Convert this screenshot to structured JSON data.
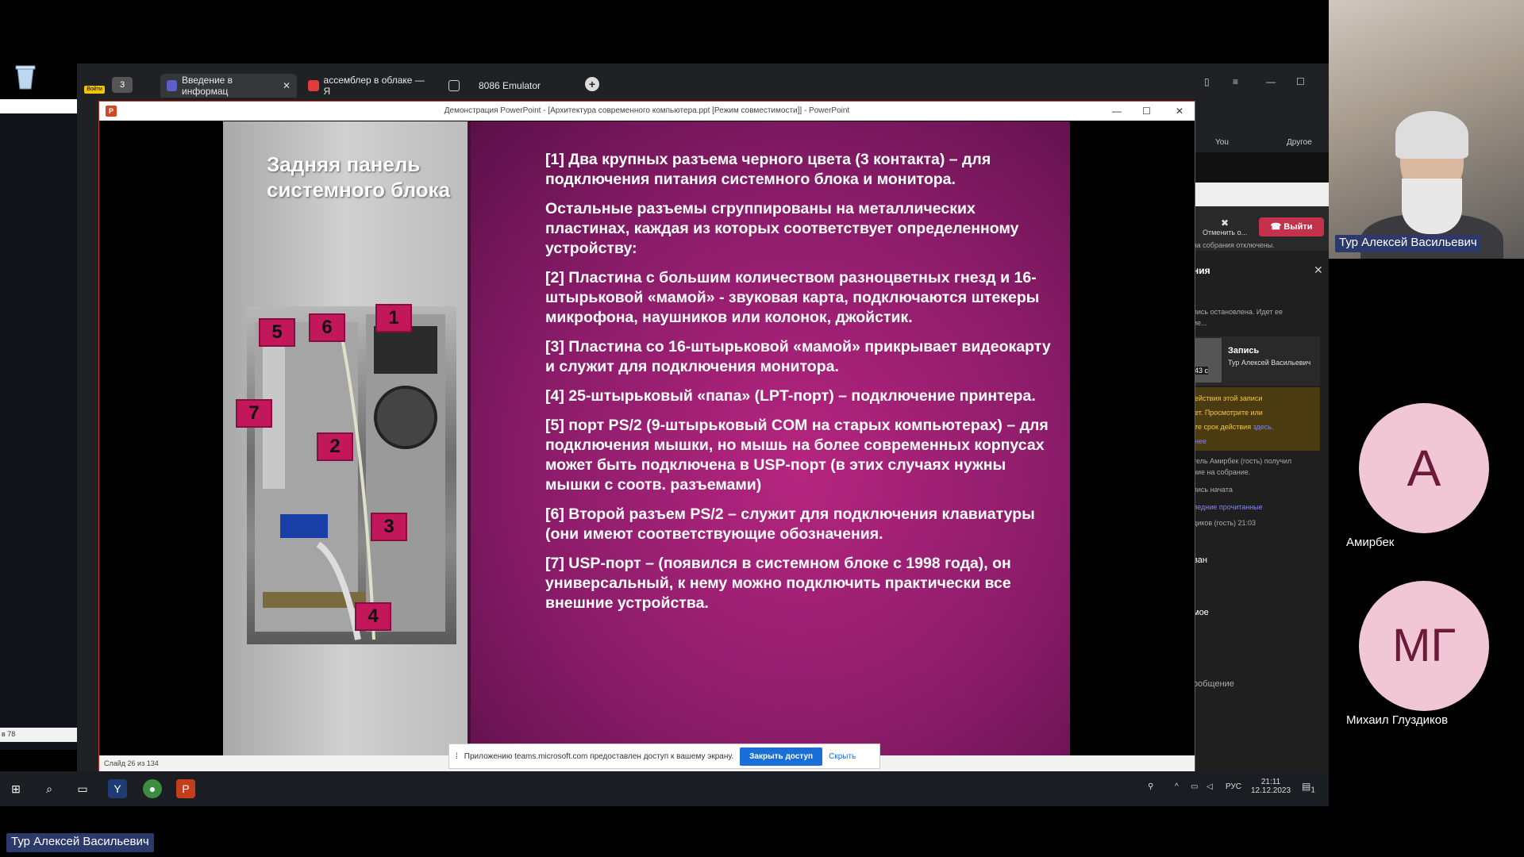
{
  "browser": {
    "tabs": [
      {
        "label": "Введение в информац"
      },
      {
        "label": "ассемблер в облаке — Я"
      },
      {
        "label": "8086 Emulator"
      }
    ],
    "tab_count": "3",
    "login_label": "Войти"
  },
  "ppt": {
    "window_title": "Демонстрация PowerPoint - [Архитектура современного компьютера.ppt [Режим совместимости]] - PowerPoint",
    "status": "Слайд 26 из 134"
  },
  "slide": {
    "heading": "Задняя панель системного блока",
    "callouts": [
      "1",
      "2",
      "3",
      "4",
      "5",
      "6",
      "7"
    ],
    "paragraphs": [
      "[1] Два крупных разъема черного цвета (3 контакта) – для подключения питания системного блока и монитора.",
      "Остальные разъемы сгруппированы на металлических пластинах, каждая из которых соответствует определенному устройству:",
      "[2] Пластина с большим количеством разноцветных гнезд и 16-штырьковой «мамой» - звуковая карта, подключаются штекеры микрофона, наушников или колонок, джойстик.",
      "[3] Пластина со 16-штырьковой «мамой» прикрывает видеокарту и служит для подключения монитора.",
      "[4] 25-штырьковый «папа» (LPT-порт) – подключение принтера.",
      "[5] порт PS/2 (9-штырьковый COM на старых компьютерах) – для подключения мышки, но мышь на более современных корпусах может быть подключена в  USP-порт (в этих случаях нужны мышки с соотв. разъемами)",
      "[6] Второй разъем PS/2 – служит для подключения клавиатуры (они имеют соответствующие обозначения.",
      "[7] USP-порт – (появился в системном блоке с 1998 года), он универсальный, к нему можно подключить практически все внешние устройства."
    ]
  },
  "share_note": {
    "text": "Приложению teams.microsoft.com предоставлен доступ к вашему экрану.",
    "stop_label": "Закрыть доступ",
    "hide_label": "Скрыть"
  },
  "teams": {
    "bookmark_you": "You",
    "bookmark_other": "Другое",
    "cancel_label": "Отменить о...",
    "exit_label": "Выйти",
    "notice": "ва собрания отключены.",
    "chat_title": "ния",
    "msg1": "пись остановлена. Идет ее",
    "msg1b": "ие...",
    "rec_title": "Запись",
    "rec_sub": "Тур Алексей Васильевич",
    "rec_dur": "43 с",
    "warn1": "ействия этой записи",
    "warn2": "ет. Просмотрите или",
    "warn3": "те срок действия",
    "warn3_link": "здесь.",
    "warn4": "нее",
    "msg2": "тель Амирбек (гость) получил",
    "msg2b": "ние на собрание.",
    "msg3": "пись начата",
    "unread": "ледние прочитанные",
    "msg4": "диков (гость)  21:03",
    "msg5": "ван",
    "msg6": "мое",
    "compose": "ообщение"
  },
  "taskbar": {
    "lang": "РУС",
    "time": "21:11",
    "date": "12.12.2023",
    "notif": "1"
  },
  "left_strip_foot": "в 78",
  "participants": {
    "speaker": "Тур Алексей Васильевич",
    "p1_initial": "А",
    "p1_name": "Амирбек",
    "p2_initial": "МГ",
    "p2_name": "Михаил Глуздиков"
  }
}
